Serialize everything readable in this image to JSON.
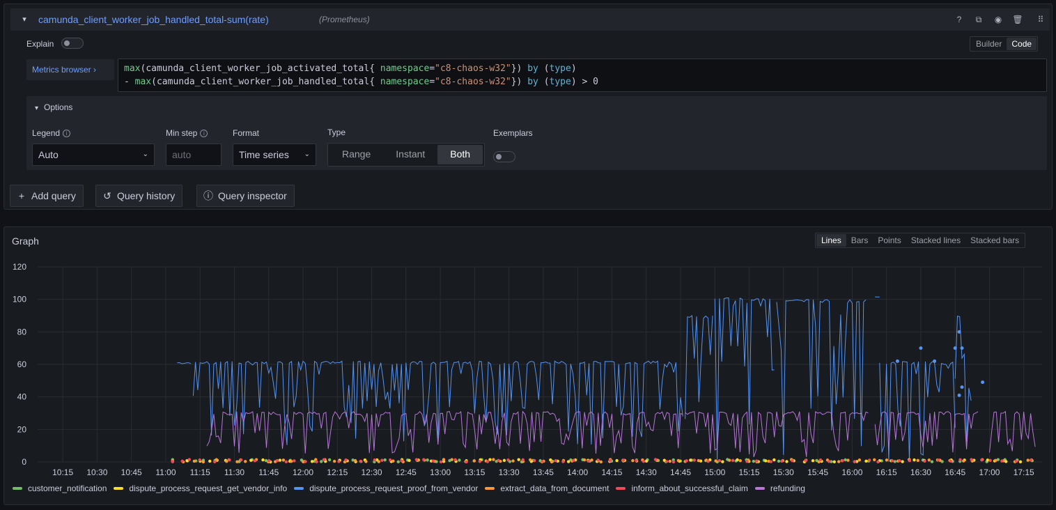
{
  "query": {
    "title": "camunda_client_worker_job_handled_total-sum(rate)",
    "datasource": "(Prometheus)",
    "explain_label": "Explain",
    "mode_options": [
      "Builder",
      "Code"
    ],
    "mode_selected": "Code",
    "metrics_browser_label": "Metrics browser ›",
    "code_line1": {
      "fn": "max",
      "metric": "camunda_client_worker_job_activated_total",
      "label": " namespace",
      "value": "\"c8-chaos-w32\"",
      "by": "by",
      "group": "type"
    },
    "code_line2": {
      "prefix": "- ",
      "fn": "max",
      "metric": "camunda_client_worker_job_handled_total",
      "label": " namespace",
      "value": "\"c8-chaos-w32\"",
      "by": "by",
      "group": "type",
      "suffix": " > 0"
    },
    "options": {
      "title": "Options",
      "legend_label": "Legend",
      "legend_value": "Auto",
      "min_step_label": "Min step",
      "min_step_placeholder": "auto",
      "format_label": "Format",
      "format_value": "Time series",
      "type_label": "Type",
      "type_options": [
        "Range",
        "Instant",
        "Both"
      ],
      "type_selected": "Both",
      "exemplars_label": "Exemplars"
    },
    "actions": {
      "add_query": "Add query",
      "query_history": "Query history",
      "query_inspector": "Query inspector"
    }
  },
  "graph": {
    "title": "Graph",
    "view_options": [
      "Lines",
      "Bars",
      "Points",
      "Stacked lines",
      "Stacked bars"
    ],
    "view_selected": "Lines"
  },
  "chart_data": {
    "type": "line",
    "x_ticks": [
      "10:15",
      "10:30",
      "10:45",
      "11:00",
      "11:15",
      "11:30",
      "11:45",
      "12:00",
      "12:15",
      "12:30",
      "12:45",
      "13:00",
      "13:15",
      "13:30",
      "13:45",
      "14:00",
      "14:15",
      "14:30",
      "14:45",
      "15:00",
      "15:15",
      "15:30",
      "15:45",
      "16:00",
      "16:15",
      "16:30",
      "16:45",
      "17:00",
      "17:15"
    ],
    "y_ticks": [
      0,
      20,
      40,
      60,
      80,
      100,
      120
    ],
    "ylim": [
      0,
      120
    ],
    "grid": true,
    "legend_position": "bottom",
    "series": [
      {
        "name": "customer_notification",
        "color": "#73bf69",
        "typical": 1
      },
      {
        "name": "dispute_process_request_get_vendor_info",
        "color": "#fade2a",
        "typical": 1
      },
      {
        "name": "dispute_process_request_proof_from_vendor",
        "color": "#5794f2",
        "segments": [
          {
            "from": "11:05",
            "to": "11:12",
            "level": 61
          },
          {
            "from": "11:12",
            "to": "14:47",
            "low": 10,
            "high": 62
          },
          {
            "from": "14:47",
            "to": "15:00",
            "low": 20,
            "high": 90
          },
          {
            "from": "15:00",
            "to": "15:27",
            "low": 0,
            "high": 101
          },
          {
            "from": "15:27",
            "to": "16:07",
            "low": 0,
            "high": 100
          },
          {
            "from": "16:10",
            "to": "16:12",
            "level": 101
          },
          {
            "from": "16:12",
            "to": "16:45",
            "low": 0,
            "high": 62
          },
          {
            "from": "16:45",
            "to": "16:52",
            "low": 0,
            "high": 90
          }
        ],
        "points": [
          [
            16.5,
            70
          ],
          [
            16.75,
            70
          ],
          [
            16.78,
            80
          ],
          [
            16.8,
            70
          ],
          [
            16.8,
            46
          ],
          [
            16.78,
            41
          ],
          [
            16.95,
            49
          ],
          [
            16.33,
            62
          ],
          [
            16.6,
            62
          ]
        ]
      },
      {
        "name": "extract_data_from_document",
        "color": "#ff9830",
        "typical": 1
      },
      {
        "name": "inform_about_successful_claim",
        "color": "#f2495c",
        "typical": 1
      },
      {
        "name": "refunding",
        "color": "#b877d9",
        "segments": [
          {
            "from": "11:18",
            "to": "14:47",
            "low": 5,
            "high": 31
          },
          {
            "from": "14:47",
            "to": "16:08",
            "low": 3,
            "high": 31
          },
          {
            "from": "16:10",
            "to": "16:55",
            "low": 5,
            "high": 31
          },
          {
            "from": "17:00",
            "to": "17:20",
            "low": 5,
            "high": 31
          }
        ]
      }
    ]
  }
}
